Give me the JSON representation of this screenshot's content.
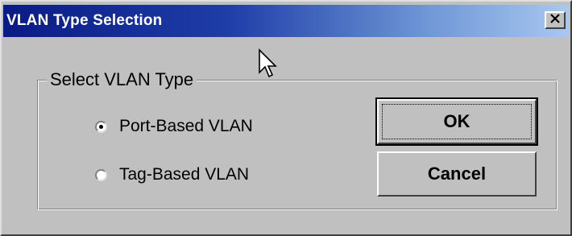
{
  "window": {
    "title": "VLAN Type Selection",
    "close_icon": "close-icon"
  },
  "group": {
    "label": "Select VLAN Type"
  },
  "options": [
    {
      "label": "Port-Based VLAN",
      "checked": true
    },
    {
      "label": "Tag-Based VLAN",
      "checked": false
    }
  ],
  "buttons": {
    "ok": "OK",
    "cancel": "Cancel"
  },
  "colors": {
    "face": "#c0c0c0",
    "title_start": "#0a1a86",
    "title_end": "#a9c8f0",
    "title_text": "#ffffff"
  },
  "pointer_icon": "mouse-pointer-icon"
}
